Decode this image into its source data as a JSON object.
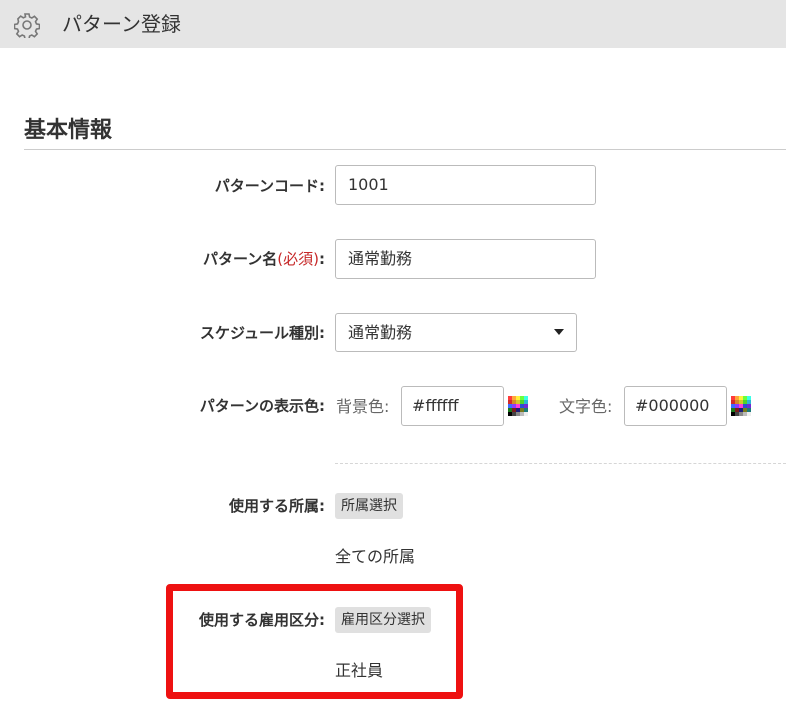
{
  "header": {
    "title": "パターン登録",
    "icon": "gear-icon"
  },
  "section": {
    "title": "基本情報"
  },
  "form": {
    "pattern_code": {
      "label": "パターンコード:",
      "value": "1001"
    },
    "pattern_name": {
      "label": "パターン名",
      "required": "(必須)",
      "suffix": ":",
      "value": "通常勤務"
    },
    "schedule_type": {
      "label": "スケジュール種別:",
      "selected": "通常勤務"
    },
    "display_color": {
      "label": "パターンの表示色:",
      "bg_label": "背景色:",
      "bg_value": "#ffffff",
      "text_label": "文字色:",
      "text_value": "#000000"
    },
    "affiliation": {
      "label": "使用する所属:",
      "button": "所属選択",
      "value": "全ての所属"
    },
    "employment": {
      "label": "使用する雇用区分:",
      "button": "雇用区分選択",
      "value": "正社員"
    }
  },
  "colors": {
    "highlight": "#ee1111",
    "required": "#c62828",
    "header_bg": "#e5e5e5"
  }
}
